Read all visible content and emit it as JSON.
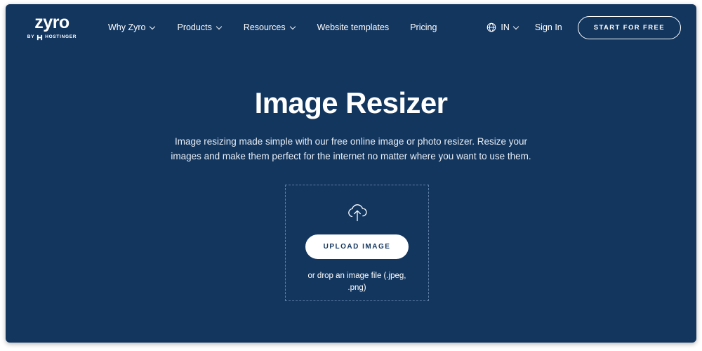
{
  "brand": {
    "logo_word": "zyro",
    "logo_by": "BY",
    "logo_parent": "HOSTINGER",
    "hostinger_mark_icon": "hostinger-h-monogram-icon"
  },
  "nav": {
    "items": [
      {
        "label": "Why Zyro",
        "has_chevron": true,
        "chevron_icon": "chevron-down-icon"
      },
      {
        "label": "Products",
        "has_chevron": true,
        "chevron_icon": "chevron-down-icon"
      },
      {
        "label": "Resources",
        "has_chevron": true,
        "chevron_icon": "chevron-down-icon"
      },
      {
        "label": "Website templates",
        "has_chevron": false
      },
      {
        "label": "Pricing",
        "has_chevron": false
      }
    ]
  },
  "header_right": {
    "globe_icon": "globe-icon",
    "locale": "IN",
    "locale_chevron_icon": "chevron-down-icon",
    "sign_in": "Sign In",
    "cta": "START FOR FREE"
  },
  "hero": {
    "title": "Image Resizer",
    "subtitle": "Image resizing made simple with our free online image or photo resizer. Resize your images and make them perfect for the internet no matter where you want to use them."
  },
  "dropzone": {
    "cloud_icon": "cloud-upload-icon",
    "upload_button": "UPLOAD IMAGE",
    "hint": "or drop an image file (.jpeg, .png)"
  },
  "colors": {
    "background": "#13365f",
    "page": "#ffffff",
    "text": "#ffffff",
    "subtitle": "#e8eef5",
    "dropzone_border": "#5f7fa6",
    "button_bg": "#ffffff",
    "button_text": "#13365f"
  }
}
